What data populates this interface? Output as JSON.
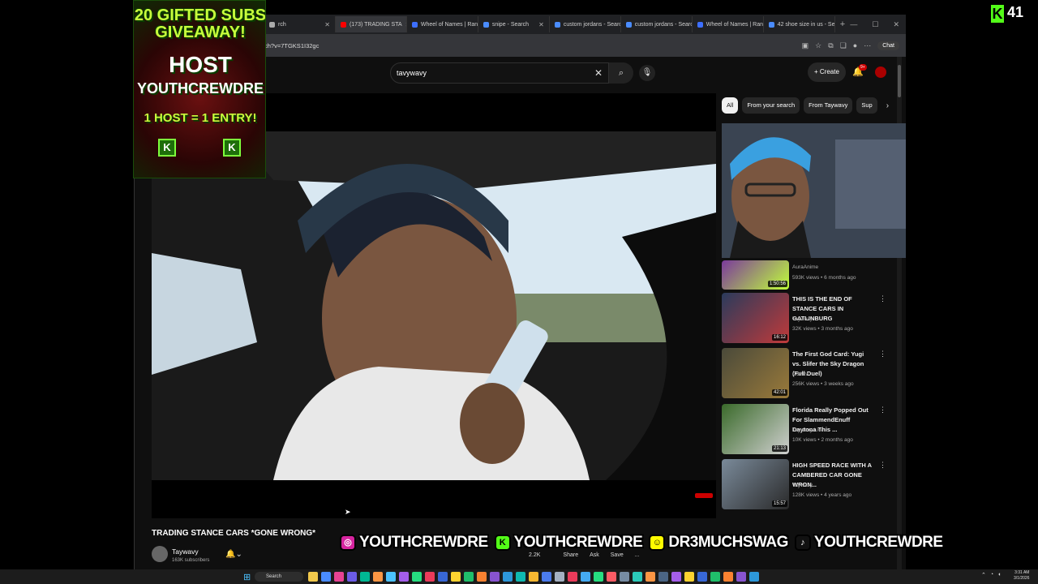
{
  "browser": {
    "tabs": [
      {
        "label": "rch",
        "color": "#aaaaaa"
      },
      {
        "label": "(173) TRADING STA",
        "color": "#ff0000",
        "active": true
      },
      {
        "label": "Wheel of Names | Rand",
        "color": "#3d6fff"
      },
      {
        "label": "snipe - Search",
        "color": "#4a8cff"
      },
      {
        "label": "custom jordans - Search",
        "color": "#4a8cff"
      },
      {
        "label": "custom jordans - Search",
        "color": "#4a8cff"
      },
      {
        "label": "Wheel of Names | Rand",
        "color": "#3d6fff"
      },
      {
        "label": "42 shoe size in us - Sea",
        "color": "#4a8cff"
      }
    ],
    "url": "ch?v=7TGKS1I32gc",
    "chat_label": "Chat"
  },
  "youtube": {
    "search_value": "tavywavy",
    "create_label": "Create",
    "notif_badge": "9+",
    "chips": [
      "All",
      "From your search",
      "From Taywavy",
      "Sup"
    ],
    "video_title": "TRADING STANCE CARS *GONE WRONG*",
    "channel_name": "Taywavy",
    "channel_subs": "163K subscribers",
    "actions": [
      "2.2K",
      "",
      "Share",
      "Ask",
      "Save",
      "..."
    ],
    "recommendations": [
      {
        "title": "",
        "channel": "AuraAnime",
        "meta": "593K views • 6 months ago",
        "duration": "1:50:56",
        "colors": [
          "#7b3a9c",
          "#c0ff3a"
        ]
      },
      {
        "title": "THIS IS THE END OF STANCE CARS IN GATLINBURG",
        "channel": "Taywavy",
        "meta": "32K views • 3 months ago",
        "duration": "16:12",
        "colors": [
          "#2a3b5c",
          "#c03a3a"
        ]
      },
      {
        "title": "The First God Card: Yugi vs. Slifer the Sky Dragon (Full Duel)",
        "channel": "CONtv",
        "meta": "256K views • 3 weeks ago",
        "duration": "42:01",
        "colors": [
          "#4a4a3a",
          "#9a7a3a"
        ]
      },
      {
        "title": "Florida Really Popped Out For SlammendEnuff Daytona This ...",
        "channel": "Taywavy Live",
        "meta": "10K views • 2 months ago",
        "duration": "21:13",
        "colors": [
          "#3a6a2a",
          "#d0d0d0"
        ]
      },
      {
        "title": "HIGH SPEED RACE WITH A CAMBERED CAR GONE WRON...",
        "channel": "Taywavy",
        "meta": "128K views • 4 years ago",
        "duration": "15:57",
        "colors": [
          "#7a8a9a",
          "#2a2a2a"
        ]
      }
    ]
  },
  "overlays": {
    "giveaway_line1": "20 GIFTED SUBS",
    "giveaway_line2": "GIVEAWAY!",
    "giveaway_line3": "HOST",
    "giveaway_line4": "YOUTHCREWDRE",
    "giveaway_line5": "1 HOST = 1 ENTRY!",
    "giveaway_k": "K",
    "kick_logo": "K",
    "viewer_count": "41",
    "socials": [
      {
        "icon": "instagram-icon",
        "glyph": "◎",
        "name": "YOUTHCREWDRE",
        "color": "#d6249f"
      },
      {
        "icon": "kick-icon",
        "glyph": "K",
        "name": "YOUTHCREWDRE",
        "color": "#53fc18"
      },
      {
        "icon": "snapchat-icon",
        "glyph": "☺",
        "name": "DR3MUCHSWAG",
        "color": "#fffc00"
      },
      {
        "icon": "tiktok-icon",
        "glyph": "♪",
        "name": "YOUTHCREWDRE",
        "color": "#111111"
      }
    ]
  },
  "taskbar": {
    "search_label": "Search",
    "clock_time": "3:31 AM",
    "clock_date": "3/1/2026"
  }
}
